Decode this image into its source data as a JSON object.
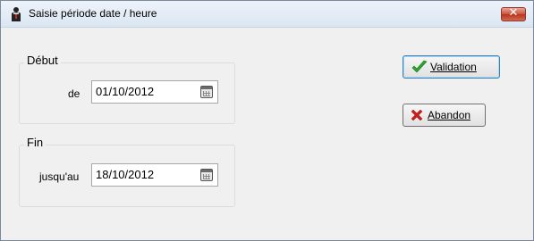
{
  "window": {
    "title": "Saisie période date / heure",
    "close_glyph": "✕"
  },
  "debut": {
    "legend": "Début",
    "label": "de",
    "value": "01/10/2012"
  },
  "fin": {
    "legend": "Fin",
    "label": "jusqu'au",
    "value": "18/10/2012"
  },
  "buttons": {
    "validation": "Validation",
    "abandon": "Abandon"
  },
  "icons": {
    "app": "person-icon",
    "calendar": "calendar-icon",
    "check": "check-icon",
    "cross": "cross-icon"
  },
  "colors": {
    "check": "#2fa32f",
    "cross": "#d11a1a",
    "close": "#c9533b"
  }
}
